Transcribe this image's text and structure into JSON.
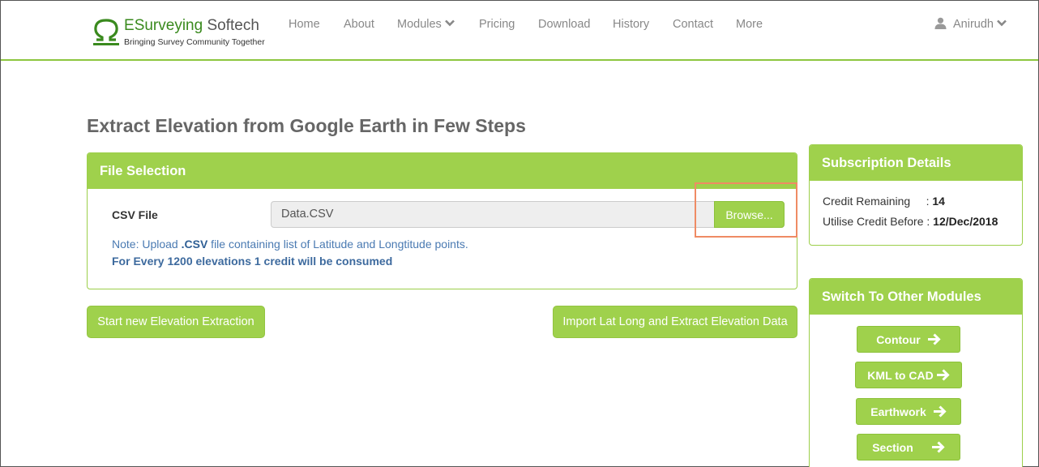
{
  "brand": {
    "name_part1": "E",
    "name_part2": "Surveying",
    "name_part3": " Softech",
    "tagline": "Bringing Survey Community Together",
    "logo_icon": "omega-logo-icon",
    "accent_color": "#9fd14c"
  },
  "nav": {
    "items": [
      {
        "label": "Home"
      },
      {
        "label": "About"
      },
      {
        "label": "Modules"
      },
      {
        "label": "Pricing"
      },
      {
        "label": "Download"
      },
      {
        "label": "History"
      },
      {
        "label": "Contact"
      },
      {
        "label": "More"
      }
    ],
    "user_name": "Anirudh"
  },
  "page": {
    "title": "Extract Elevation from Google Earth in Few Steps"
  },
  "file_selection": {
    "title": "File Selection",
    "csv_label": "CSV File",
    "file_value": "Data.CSV",
    "browse_label": "Browse...",
    "note_prefix": "Note: Upload ",
    "note_ext": ".CSV",
    "note_suffix": " file containing list of Latitude and Longtitude points.",
    "credit_note": "For Every 1200 elevations 1 credit will be consumed"
  },
  "actions": {
    "start_label": "Start new Elevation Extraction",
    "import_label": "Import Lat Long and Extract Elevation Data"
  },
  "subscription": {
    "title": "Subscription Details",
    "credit_label": "Credit Remaining     : ",
    "credit_value": "14",
    "utilise_label": "Utilise Credit Before : ",
    "utilise_value": "12/Dec/2018"
  },
  "modules": {
    "title": "Switch To Other Modules",
    "items": [
      {
        "label": "Contour"
      },
      {
        "label": "KML to CAD"
      },
      {
        "label": "Earthwork"
      },
      {
        "label": "Section"
      }
    ]
  }
}
